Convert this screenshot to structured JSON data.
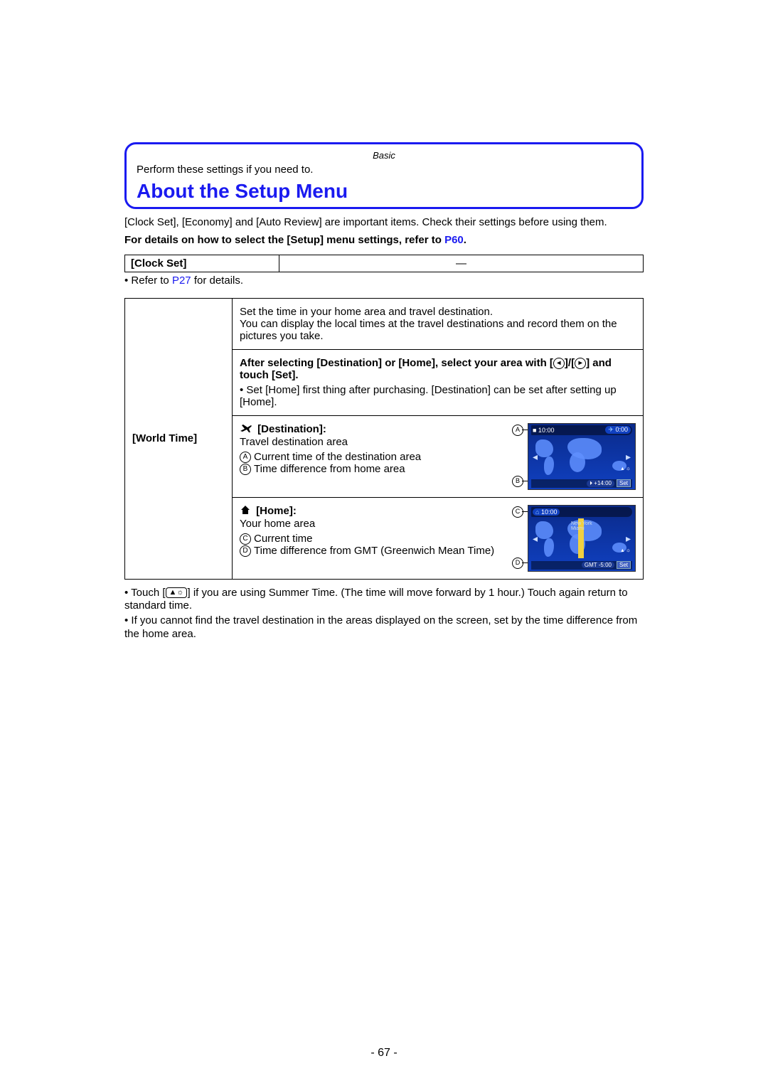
{
  "header": {
    "category": "Basic",
    "intro": "Perform these settings if you need to.",
    "title": "About the Setup Menu"
  },
  "body": {
    "p1": "[Clock Set], [Economy] and [Auto Review] are important items. Check their settings before using them.",
    "p2a": "For details on how to select the [Setup] menu settings, refer to ",
    "p2link": "P60",
    "p2b": "."
  },
  "clock_table": {
    "label": "[Clock Set]",
    "value": "—",
    "note_prefix": "• Refer to ",
    "note_link": "P27",
    "note_suffix": " for details."
  },
  "world": {
    "label": "[World Time]",
    "cell1": "Set the time in your home area and travel destination.\nYou can display the local times at the travel destinations and record them on the pictures you take.",
    "cell2_bold": "After selecting [Destination] or [Home], select your area with [  ]/[  ] and touch [Set].",
    "cell2_line": "• Set [Home] first thing after purchasing. [Destination] can be set after setting up [Home].",
    "dest": {
      "title": "[Destination]:",
      "sub": "Travel destination area",
      "a": "Current time of the destination area",
      "b": "Time difference from home area",
      "time": "0:00",
      "set": "Set"
    },
    "home": {
      "title": "[Home]:",
      "sub": "Your home area",
      "c": "Current time",
      "d": "Time difference from GMT (Greenwich Mean Time)",
      "time": "10:00",
      "set": "Set"
    }
  },
  "notes": {
    "n1a": "• Touch [",
    "n1b": "] if you are using Summer Time. (The time will move forward by 1 hour.) Touch again return to standard time.",
    "n2": "• If you cannot find the travel destination in the areas displayed on the screen, set by the time difference from the home area."
  },
  "labels": {
    "A": "A",
    "B": "B",
    "C": "C",
    "D": "D",
    "left": "◂",
    "right": "▸"
  },
  "page": "- 67 -"
}
